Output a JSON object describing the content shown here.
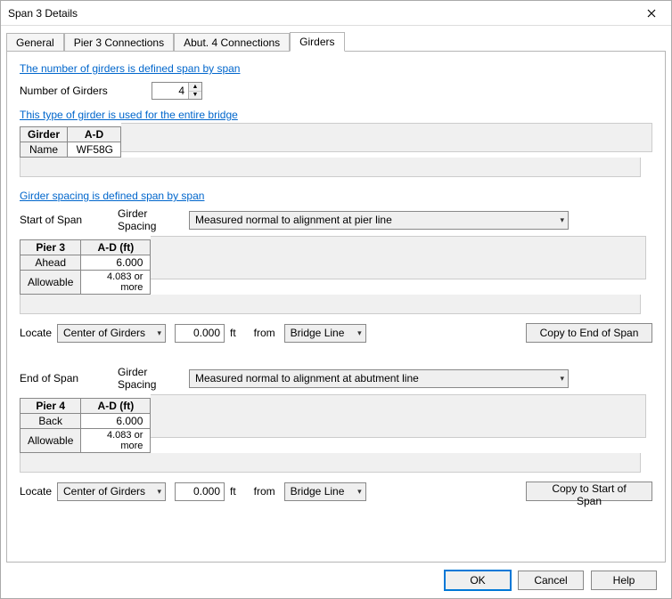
{
  "window": {
    "title": "Span 3 Details"
  },
  "tabs": [
    {
      "label": "General"
    },
    {
      "label": "Pier 3 Connections"
    },
    {
      "label": "Abut. 4 Connections"
    },
    {
      "label": "Girders"
    }
  ],
  "links": {
    "num_girders": "The number of girders is defined span by span",
    "girder_type": "This type of girder is used for the entire bridge",
    "girder_spacing": "Girder spacing is defined span by span"
  },
  "num_girders": {
    "label": "Number of Girders",
    "value": "4"
  },
  "type_table": {
    "headers": [
      "Girder",
      "A-D"
    ],
    "row": [
      "Name",
      "WF58G"
    ]
  },
  "start": {
    "title": "Start of Span",
    "spacing_label": "Girder Spacing",
    "spacing_method": "Measured normal to alignment at pier line",
    "table": {
      "headers": [
        "Pier 3",
        "A-D (ft)"
      ],
      "rows": [
        [
          "Ahead",
          "6.000"
        ],
        [
          "Allowable",
          "4.083 or more"
        ]
      ]
    },
    "locate_label": "Locate",
    "locate_method": "Center of Girders",
    "locate_value": "0.000",
    "locate_unit": "ft",
    "from_label": "from",
    "from_ref": "Bridge Line",
    "copy_btn": "Copy to End of Span"
  },
  "end": {
    "title": "End of Span",
    "spacing_label": "Girder Spacing",
    "spacing_method": "Measured normal to alignment at abutment line",
    "table": {
      "headers": [
        "Pier 4",
        "A-D (ft)"
      ],
      "rows": [
        [
          "Back",
          "6.000"
        ],
        [
          "Allowable",
          "4.083 or more"
        ]
      ]
    },
    "locate_label": "Locate",
    "locate_method": "Center of Girders",
    "locate_value": "0.000",
    "locate_unit": "ft",
    "from_label": "from",
    "from_ref": "Bridge Line",
    "copy_btn": "Copy to Start of Span"
  },
  "footer": {
    "ok": "OK",
    "cancel": "Cancel",
    "help": "Help"
  }
}
